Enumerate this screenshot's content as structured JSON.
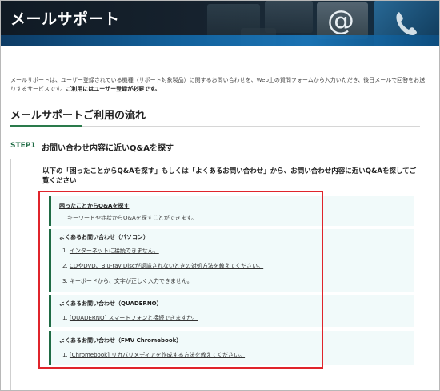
{
  "banner": {
    "title": "メールサポート",
    "at_icon": "@"
  },
  "intro": {
    "text": "メールサポートは、ユーザー登録されている機種（サポート対象製品）に関するお問い合わせを、Web上の質問フォームから入力いただき、後日メールで回答をお送りするサービスです。",
    "bold": "ご利用にはユーザー登録が必要です。"
  },
  "section": {
    "title": "メールサポートご利用の流れ"
  },
  "step": {
    "label": "STEP1",
    "title": "お問い合わせ内容に近いQ&Aを探す",
    "instruction": "以下の「困ったことからQ&Aを探す」もしくは「よくあるお問い合わせ」から、お問い合わせ内容に近いQ&Aを探してご覧ください"
  },
  "boxes": [
    {
      "title": "困ったことからQ&Aを探す",
      "desc": "キーワードや症状からQ&Aを探すことができます。"
    },
    {
      "title": "よくあるお問い合わせ（パソコン）",
      "items": [
        {
          "num": "1.",
          "text": "インターネットに接続できません。"
        },
        {
          "num": "2.",
          "text": "CDやDVD、Blu-ray Discが認識されないときの対処方法を教えてください。"
        },
        {
          "num": "3.",
          "text": "キーボードから、文字が正しく入力できません。"
        }
      ]
    },
    {
      "title": "よくあるお問い合わせ（QUADERNO）",
      "items": [
        {
          "num": "1.",
          "text": "[QUADERNO] スマートフォンと接続できますか。"
        }
      ]
    },
    {
      "title": "よくあるお問い合わせ（FMV Chromebook）",
      "items": [
        {
          "num": "1.",
          "text": "[Chromebook] リカバリメディアを作成する方法を教えてください。"
        }
      ]
    }
  ],
  "colors": {
    "accent_green": "#1f6b44",
    "highlight_red": "#e0242b",
    "box_bg": "#f1fafa"
  }
}
